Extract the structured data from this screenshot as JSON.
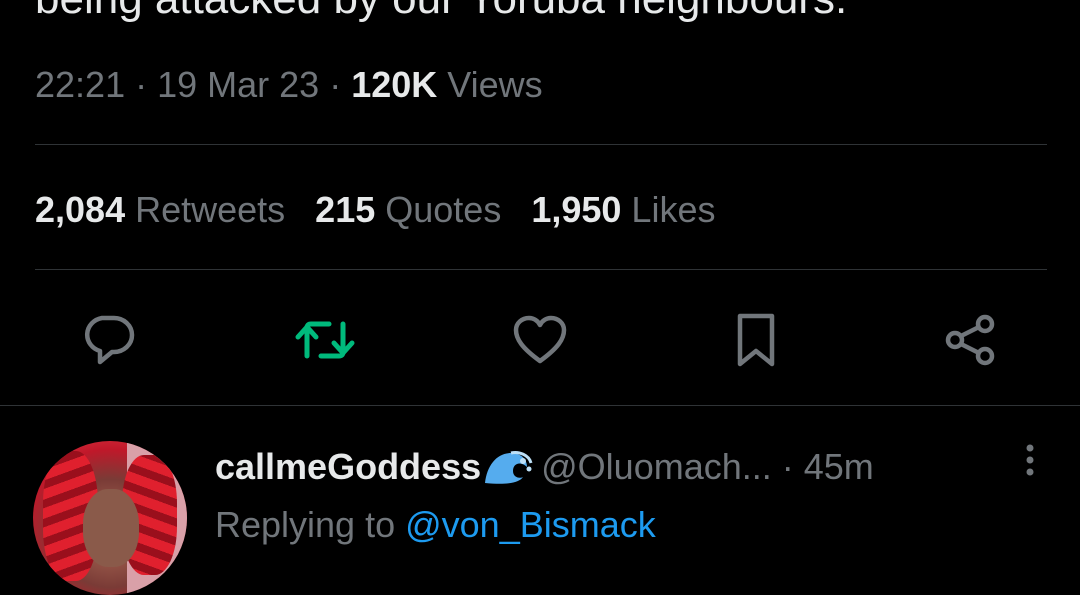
{
  "tweet": {
    "text_fragment": "being attacked by our Yoruba neighbours.",
    "time": "22:21",
    "separator": " · ",
    "date": "19 Mar 23",
    "views_count": "120K",
    "views_label": " Views"
  },
  "stats": {
    "retweets_count": "2,084",
    "retweets_label": " Retweets",
    "quotes_count": "215",
    "quotes_label": " Quotes",
    "likes_count": "1,950",
    "likes_label": " Likes"
  },
  "actions": {
    "icons": [
      "reply-icon",
      "retweet-icon",
      "like-icon",
      "bookmark-icon",
      "share-icon"
    ],
    "icon_color": "#71767b",
    "retweet_active_color": "#00ba7c"
  },
  "reply": {
    "display_name": "callmeGoddess",
    "emoji_icon": "wave-emoji-icon",
    "handle": "@Oluomach...",
    "separator": " · ",
    "time_ago": "45m",
    "replying_prefix": "Replying to ",
    "replying_to": "@von_Bismack"
  },
  "colors": {
    "background": "#000000",
    "text_primary": "#e7e9ea",
    "text_secondary": "#71767b",
    "link": "#1d9bf0",
    "divider": "#2f3336"
  }
}
